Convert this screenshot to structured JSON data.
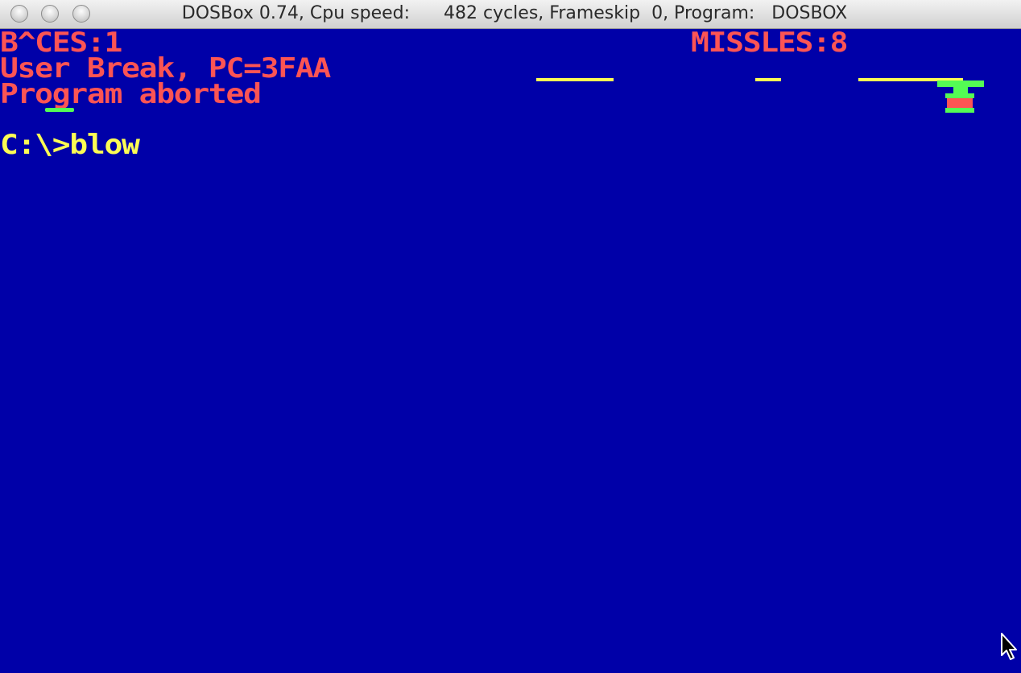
{
  "window": {
    "title": "DOSBox 0.74, Cpu speed:      482 cycles, Frameskip  0, Program:   DOSBOX"
  },
  "screen": {
    "line1": "B^CES:1",
    "missles": "MISSLES:8",
    "line2": "User Break, PC=3FAA",
    "line3": "Program aborted",
    "prompt": "C:\\>blow"
  },
  "colors": {
    "background": "#0000a8",
    "red_text": "#fc5454",
    "yellow_text": "#fcfc54",
    "green": "#54fc54"
  },
  "icons": {
    "close": "close-button-icon",
    "minimize": "minimize-button-icon",
    "zoom": "zoom-button-icon",
    "cursor": "mouse-pointer-icon",
    "turret": "missile-turret-icon"
  }
}
